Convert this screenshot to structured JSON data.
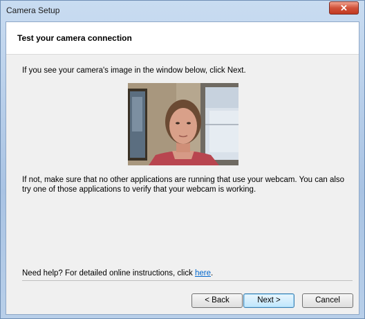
{
  "window": {
    "title": "Camera Setup",
    "close_glyph": "✕"
  },
  "header": {
    "title": "Test your camera connection"
  },
  "body": {
    "intro": "If you see your camera's image in the window below, click Next.",
    "help_line1": "If not, make sure that no other applications are running that use your webcam.  You can also",
    "help_line2": "try one of those applications to verify that your webcam is working.",
    "need_help_prefix": "Need help?  For detailed online instructions, click ",
    "need_help_link": "here",
    "need_help_suffix": "."
  },
  "buttons": {
    "back": "< Back",
    "next": "Next >",
    "cancel": "Cancel"
  },
  "colors": {
    "link": "#0066cc",
    "accent": "#3c7fb1"
  }
}
